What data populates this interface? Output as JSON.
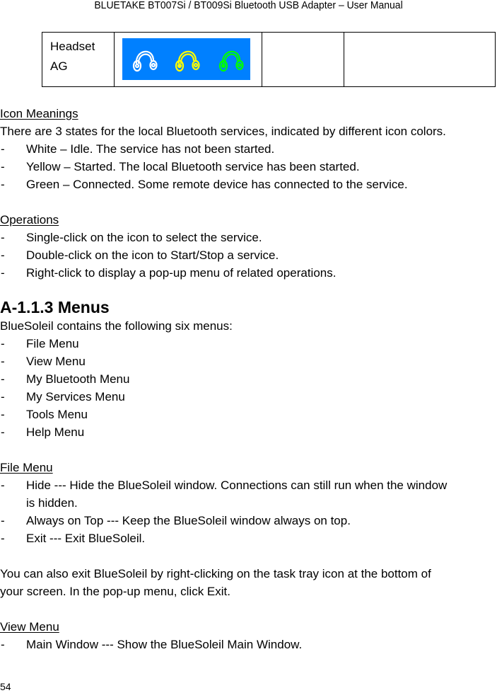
{
  "header": {
    "title": "BLUETAKE BT007Si / BT009Si Bluetooth USB Adapter – User Manual"
  },
  "table": {
    "row": {
      "label_line1": "Headset",
      "label_line2": "AG",
      "icons": [
        {
          "name": "headset-white-icon",
          "state": "Idle",
          "color": "#ffffff"
        },
        {
          "name": "headset-yellow-icon",
          "state": "Started",
          "color": "#ffff00"
        },
        {
          "name": "headset-green-icon",
          "state": "Connected",
          "color": "#00ff00"
        }
      ],
      "icon_panel_color": "#0080ff",
      "col3": "",
      "col4": ""
    }
  },
  "icon_meanings": {
    "heading": "Icon Meanings",
    "intro": "There are 3 states for the local Bluetooth services, indicated by different icon colors.",
    "bullet": "-",
    "items": [
      "White – Idle. The service has not been started.",
      "Yellow – Started. The local Bluetooth service has been started.",
      "Green – Connected. Some remote device has connected to the service."
    ]
  },
  "operations": {
    "heading": "Operations",
    "items": [
      "Single-click on the icon to select the service.",
      "Double-click on the icon to Start/Stop a service.",
      "Right-click to display a pop-up menu of related operations."
    ]
  },
  "menus_section": {
    "title": "A-1.1.3 Menus",
    "intro": "BlueSoleil contains the following six menus:",
    "items": [
      "File Menu",
      "View Menu",
      "My Bluetooth Menu",
      "My Services Menu",
      "Tools Menu",
      "Help Menu"
    ]
  },
  "file_menu": {
    "heading": "File Menu",
    "items": [
      {
        "line1": "Hide --- Hide the BlueSoleil window. Connections can still run when the window",
        "line2": "is hidden."
      },
      {
        "line1": "Always on Top --- Keep the BlueSoleil window always on top."
      },
      {
        "line1": "Exit --- Exit BlueSoleil."
      }
    ],
    "note_line1": "You can also exit BlueSoleil by right-clicking on the task tray icon at the bottom of",
    "note_line2": "your screen. In the pop-up menu, click Exit."
  },
  "view_menu": {
    "heading": "View Menu",
    "items": [
      "Main Window --- Show the BlueSoleil Main Window."
    ]
  },
  "footer": {
    "page_number": "54"
  }
}
